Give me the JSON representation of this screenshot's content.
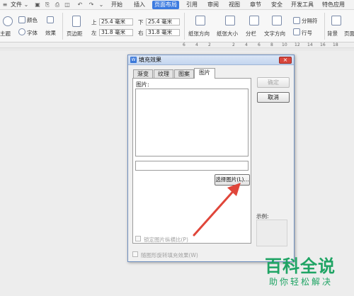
{
  "menubar": {
    "file_label": "文件",
    "tabs": [
      {
        "label": "开始",
        "active": false
      },
      {
        "label": "插入",
        "active": false
      },
      {
        "label": "页面布局",
        "active": true
      },
      {
        "label": "引用",
        "active": false
      },
      {
        "label": "审阅",
        "active": false
      },
      {
        "label": "视图",
        "active": false
      },
      {
        "label": "章节",
        "active": false
      },
      {
        "label": "安全",
        "active": false
      },
      {
        "label": "开发工具",
        "active": false
      },
      {
        "label": "特色应用",
        "active": false
      }
    ],
    "active_color": "#3d7be0"
  },
  "ribbon": {
    "theme_label": "主题",
    "color_label": "颜色",
    "font_label": "字体",
    "effect_label": "效果",
    "margin_label": "页边距",
    "top_label": "上",
    "bottom_label": "下",
    "left_label": "左",
    "right_label": "右",
    "top_value": "25.4 毫米",
    "bottom_value": "25.4 毫米",
    "left_value": "31.8 毫米",
    "right_value": "31.8 毫米",
    "orientation_label": "纸张方向",
    "size_label": "纸张大小",
    "columns_label": "分栏",
    "text_direction_label": "文字方向",
    "separator_label": "分隔符",
    "line_number_label": "行号",
    "background_label": "背景",
    "page_label": "页面"
  },
  "ruler": {
    "numbers": [
      "6",
      "4",
      "2",
      "2",
      "4",
      "6",
      "8",
      "10",
      "12",
      "14",
      "16",
      "18"
    ]
  },
  "dialog": {
    "title": "填充效果",
    "close_label": "×",
    "tabs": [
      {
        "label": "渐变",
        "active": false
      },
      {
        "label": "纹理",
        "active": false
      },
      {
        "label": "图案",
        "active": false
      },
      {
        "label": "图片",
        "active": true
      }
    ],
    "picture_label": "图片:",
    "path_value": "",
    "select_picture_button": "选择图片(L)...",
    "lock_ratio_label": "锁定图片纵横比(P)",
    "rotate_with_shape_label": "随图形旋转填充效果(W)",
    "ok_button": "确定",
    "cancel_button": "取消",
    "sample_label": "示例:"
  },
  "watermark": {
    "line1": "百科全说",
    "line2": "助你轻松解决",
    "color": "#1fa464"
  },
  "annotation": {
    "arrow_color": "#e0463a"
  }
}
